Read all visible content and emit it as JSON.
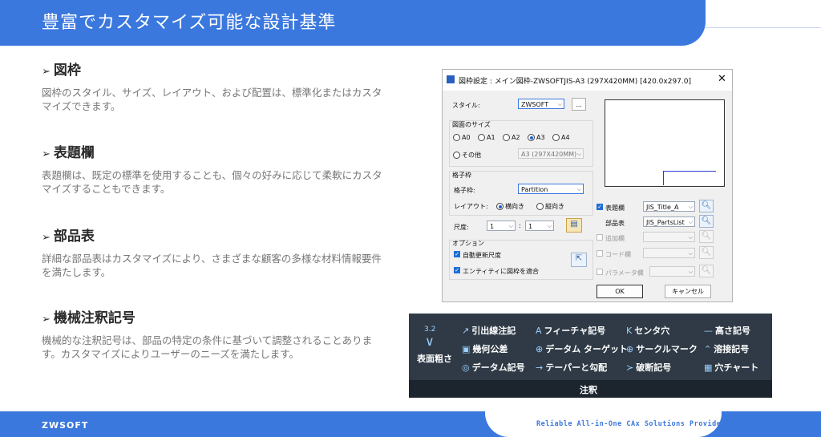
{
  "header": {
    "title": "豊富でカスタマイズ可能な設計基準"
  },
  "sections": [
    {
      "heading": "図枠",
      "text": "図枠のスタイル、サイズ、レイアウト、および配置は、標準化またはカスタマイズできます。"
    },
    {
      "heading": "表題欄",
      "text": "表題欄は、既定の標準を使用することも、個々の好みに応じて柔軟にカスタマイズすることもできます。"
    },
    {
      "heading": "部品表",
      "text": "詳細な部品表はカスタマイズにより、さまざまな顧客の多様な材料情報要件を満たします。"
    },
    {
      "heading": "機械注釈記号",
      "text": "機械的な注釈記号は、部品の特定の条件に基づいて調整されることあります。カスタマイズによりユーザーのニーズを満たします。"
    }
  ],
  "dialog": {
    "title": "図枠設定 : メイン図枠-ZWSOFTJIS-A3    (297X420MM) [420.0x297.0]",
    "style_label": "スタイル:",
    "style_value": "ZWSOFT",
    "browse_label": "...",
    "size_group": "図面のサイズ",
    "sizes": [
      "A0",
      "A1",
      "A2",
      "A3",
      "A4"
    ],
    "selected_size": "A3",
    "other_label": "その他",
    "other_value": "A3  (297X420MM)",
    "grid_group": "格子枠",
    "grid_label": "格子枠:",
    "grid_value": "Partition",
    "layout_label": "レイアウト:",
    "layout_horizontal": "横向き",
    "layout_vertical": "縦向き",
    "scale_label": "尺度:",
    "scale_a": "1",
    "scale_sep": ":",
    "scale_b": "1",
    "options_group": "オプション",
    "opt_autoupdate": "自動更新尺度",
    "opt_fit_entity": "エンティティに図枠を適合",
    "title_block_label": "表題欄",
    "title_block_value": "JIS_Title_A",
    "parts_list_label": "部品表",
    "parts_list_value": "JIS_PartsList",
    "additional_label": "追加欄",
    "code_label": "コード欄",
    "param_label": "パラメータ欄",
    "ok_label": "OK",
    "cancel_label": "キャンセル"
  },
  "ribbon": {
    "big_button": {
      "label": "表面粗さ",
      "glyph": "3.2"
    },
    "items": [
      {
        "label": "引出線注記",
        "icon": "leader-icon",
        "glyph": "↗"
      },
      {
        "label": "フィーチャ記号",
        "icon": "feature-icon",
        "glyph": "A"
      },
      {
        "label": "センタ穴",
        "icon": "center-hole-icon",
        "glyph": "K"
      },
      {
        "label": "高さ記号",
        "icon": "height-icon",
        "glyph": "—"
      },
      {
        "label": "幾何公差",
        "icon": "tolerance-icon",
        "glyph": "▣"
      },
      {
        "label": "データム ターゲット",
        "icon": "datum-target-icon",
        "glyph": "⊕"
      },
      {
        "label": "サークルマーク",
        "icon": "circle-mark-icon",
        "glyph": "⊕"
      },
      {
        "label": "溶接記号",
        "icon": "weld-icon",
        "glyph": "⌃"
      },
      {
        "label": "データム記号",
        "icon": "datum-icon",
        "glyph": "◎"
      },
      {
        "label": "テーパーと勾配",
        "icon": "taper-icon",
        "glyph": "→"
      },
      {
        "label": "破断記号",
        "icon": "break-icon",
        "glyph": "≻"
      },
      {
        "label": "穴チャート",
        "icon": "hole-chart-icon",
        "glyph": "▦"
      }
    ],
    "panel_label": "注釈"
  },
  "footer": {
    "logo": "ZWSOFT",
    "tagline": "Reliable All-in-One CAx Solutions Provider"
  },
  "colors": {
    "brand_blue": "#3a78de",
    "ribbon_bg": "#2f3a46"
  }
}
